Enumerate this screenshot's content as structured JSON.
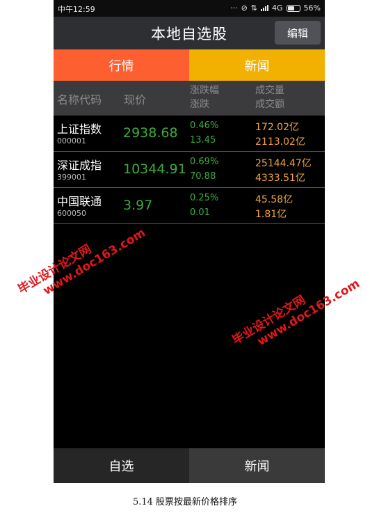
{
  "status_bar": {
    "time": "中午12:59",
    "network": "4G",
    "battery": "56%"
  },
  "header": {
    "title": "本地自选股",
    "edit_label": "编辑"
  },
  "tabs": [
    {
      "label": "行情",
      "color": "#fe5f31"
    },
    {
      "label": "新闻",
      "color": "#f2b100"
    }
  ],
  "columns": {
    "name": "名称代码",
    "price": "现价",
    "change_pct": "涨跌幅",
    "change": "涨跌",
    "volume": "成交量",
    "amount": "成交额"
  },
  "stocks": [
    {
      "name": "上证指数",
      "code": "000001",
      "price": "2938.68",
      "change_pct": "0.46%",
      "change": "13.45",
      "volume": "172.02亿",
      "amount": "2113.02亿"
    },
    {
      "name": "深证成指",
      "code": "399001",
      "price": "10344.91",
      "change_pct": "0.69%",
      "change": "70.88",
      "volume": "25144.47亿",
      "amount": "4333.51亿"
    },
    {
      "name": "中国联通",
      "code": "600050",
      "price": "3.97",
      "change_pct": "0.25%",
      "change": "0.01",
      "volume": "45.58亿",
      "amount": "1.81亿"
    }
  ],
  "bottom_nav": [
    {
      "label": "自选"
    },
    {
      "label": "新闻"
    }
  ],
  "watermarks": [
    {
      "line1": "毕业设计论文网",
      "line2": "www.doc163.com"
    },
    {
      "line1": "毕业设计论文网",
      "line2": "www.doc163.com"
    }
  ],
  "caption": "5.14 股票按最新价格排序"
}
